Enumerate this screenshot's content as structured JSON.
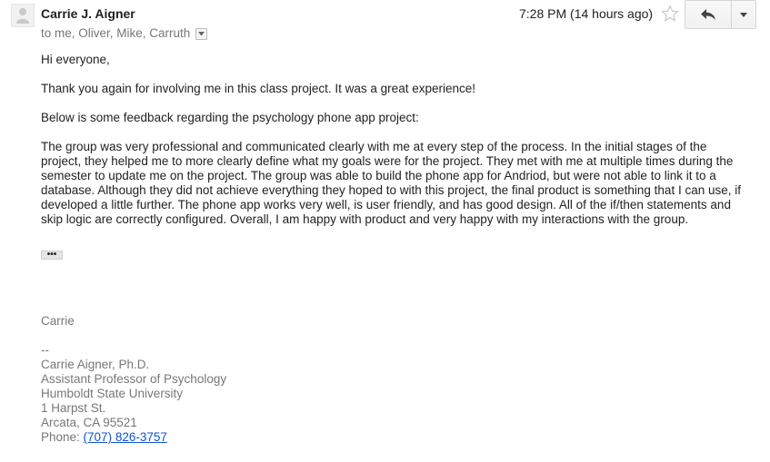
{
  "header": {
    "sender": "Carrie J. Aigner",
    "recipients": "to me, Oliver, Mike, Carruth",
    "timestamp": "7:28 PM (14 hours ago)"
  },
  "icons": {
    "avatar": "person-icon",
    "star": "star-icon",
    "reply": "reply-icon",
    "more": "chevron-down-icon",
    "recipients_toggle": "chevron-down-icon"
  },
  "message": {
    "greeting": "Hi everyone,",
    "line1": "Thank you again for involving me in this class project. It was a great experience!",
    "line2": "Below is some feedback regarding the psychology phone app project:",
    "paragraph": "The group was very professional and communicated clearly with me at every step of the process. In the initial stages of the project, they helped me to more clearly define what my goals were for the project. They met with me at multiple times during the semester to update me on the project. The group was able to build the phone app for Andriod, but were not able to link it to a database. Although they did not achieve everything they hoped to with this project, the final product is something that I can use, if developed a little further. The phone app works very well, is user friendly, and has good design. All of the if/then statements and skip logic are correctly configured. Overall, I am happy with product and very happy with my interactions with the group.",
    "trimmed_toggle": "•••"
  },
  "signature": {
    "name": "Carrie",
    "dashes": "--",
    "full_name": "Carrie Aigner, Ph.D.",
    "title": "Assistant Professor of Psychology",
    "university": "Humboldt State University",
    "street": "1 Harpst St.",
    "city": "Arcata, CA 95521",
    "phone_label": "Phone: ",
    "phone": "(707) 826-3757"
  },
  "colors": {
    "link": "#1155cc",
    "muted_text": "#777777",
    "body_text": "#222222"
  }
}
